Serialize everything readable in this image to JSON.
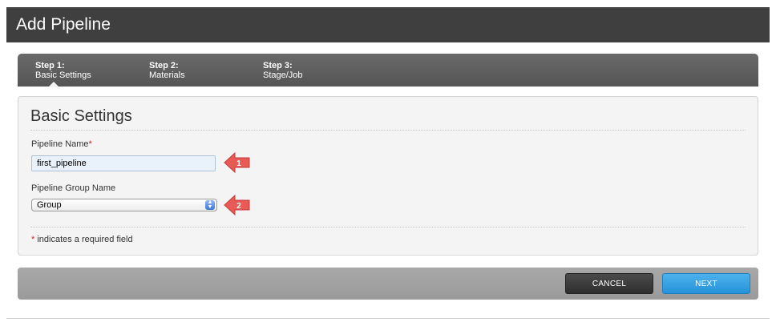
{
  "header": {
    "title": "Add Pipeline"
  },
  "wizard": {
    "steps": [
      {
        "number": "Step 1:",
        "name": "Basic Settings"
      },
      {
        "number": "Step 2:",
        "name": "Materials"
      },
      {
        "number": "Step 3:",
        "name": "Stage/Job"
      }
    ],
    "active_step": 1
  },
  "panel": {
    "title": "Basic Settings",
    "pipeline_name_label": "Pipeline Name",
    "pipeline_name_required_mark": "*",
    "pipeline_name_value": "first_pipeline",
    "group_label": "Pipeline Group Name",
    "group_value": "Group",
    "footnote_mark": "*",
    "footnote_text": " indicates a required field"
  },
  "callouts": [
    "1",
    "2"
  ],
  "footer": {
    "cancel_label": "CANCEL",
    "next_label": "NEXT"
  },
  "colors": {
    "header_bg": "#3f3f3f",
    "callout": "#e85a55",
    "next_button": "#2592d9"
  }
}
